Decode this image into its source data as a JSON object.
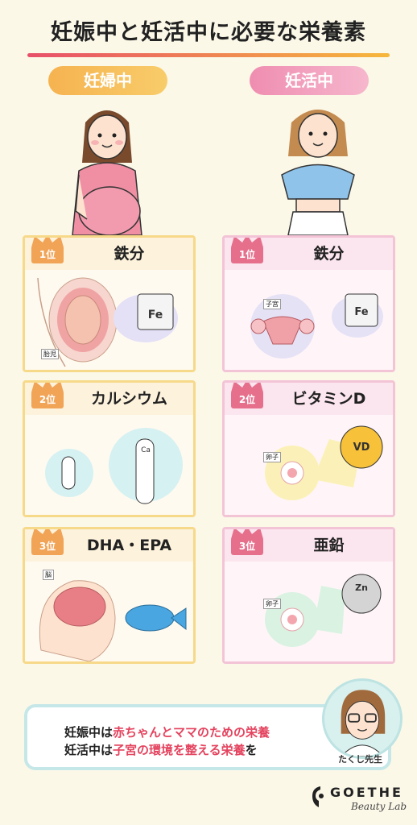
{
  "title": "妊娠中と妊活中に必要な栄養素",
  "columns": {
    "pregnancy": "妊婦中",
    "trying": "妊活中"
  },
  "cards_left": [
    {
      "rank": "1位",
      "name": "鉄分",
      "tags": [
        "胎児"
      ],
      "item_text": "Fe"
    },
    {
      "rank": "2位",
      "name": "カルシウム",
      "tags": [],
      "item_text": "Ca"
    },
    {
      "rank": "3位",
      "name": "DHA・EPA",
      "tags": [
        "脳"
      ],
      "item_text": ""
    }
  ],
  "cards_right": [
    {
      "rank": "1位",
      "name": "鉄分",
      "tags": [
        "子宮"
      ],
      "item_text": "Fe"
    },
    {
      "rank": "2位",
      "name": "ビタミンD",
      "tags": [
        "卵子"
      ],
      "item_text": "VD"
    },
    {
      "rank": "3位",
      "name": "亜鉛",
      "tags": [
        "卵子"
      ],
      "item_text": "Zn"
    }
  ],
  "summary": {
    "line1_a": "妊娠中は",
    "line1_b": "赤ちゃんとママのための栄養",
    "line2_a": "妊活中は",
    "line2_b": "子宮の環境を整える栄養",
    "line2_c": "を"
  },
  "teacher": "たくし先生",
  "logo": {
    "main": "GOETHE",
    "sub": "Beauty Lab"
  },
  "colors": {
    "accent_pink": "#e4435e",
    "accent_orange": "#f1a356",
    "teal": "#c6e7e8"
  }
}
